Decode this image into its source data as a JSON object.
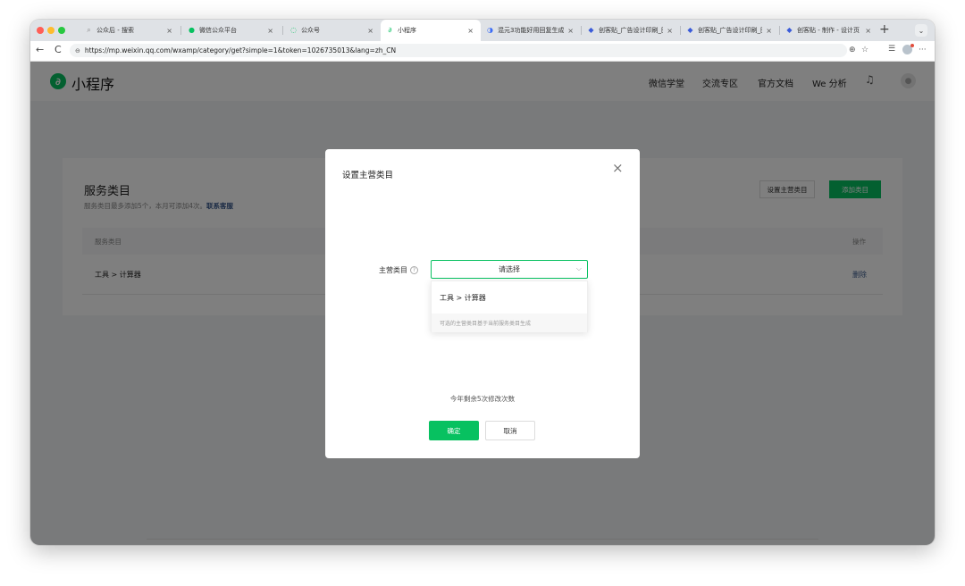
{
  "browser": {
    "tabs": [
      {
        "icon": "search-icon",
        "icon_glyph": "⌕",
        "icon_color": "#8a8a8a",
        "label": "公众后 - 搜索"
      },
      {
        "icon": "wechat-icon",
        "icon_glyph": "●",
        "icon_color": "#07c160",
        "label": "微信公众平台"
      },
      {
        "icon": "gongzhonghao-icon",
        "icon_glyph": "◌",
        "icon_color": "#07c160",
        "label": "公众号"
      },
      {
        "icon": "miniprogram-icon",
        "icon_glyph": "∂",
        "icon_color": "#07c160",
        "label": "小程序"
      },
      {
        "icon": "chatbot-icon",
        "icon_glyph": "◑",
        "icon_color": "#3b6cf6",
        "label": "混元3功能好用回复生成"
      },
      {
        "icon": "chuangkit-icon",
        "icon_glyph": "◆",
        "icon_color": "#3a5bd9",
        "label": "创客贴_广告设计印刷_图"
      },
      {
        "icon": "chuangkit-icon",
        "icon_glyph": "◆",
        "icon_color": "#3a5bd9",
        "label": "创客贴_广告设计印刷_图"
      },
      {
        "icon": "chuangkit-icon",
        "icon_glyph": "◆",
        "icon_color": "#3a5bd9",
        "label": "创客贴 - 制作 - 设计页"
      }
    ],
    "close_glyph": "×",
    "new_tab_glyph": "+",
    "tab_menu_glyph": "⌄",
    "back_glyph": "←",
    "forward_glyph": "C",
    "url": "https://mp.weixin.qq.com/wxamp/category/get?simple=1&token=1026735013&lang=zh_CN",
    "lock_glyph": "⊖",
    "translate_glyph": "⊕",
    "star_glyph": "☆",
    "favorites_glyph": "☰",
    "more_glyph": "···"
  },
  "app": {
    "logo_glyph": "∂",
    "title": "小程序",
    "nav": [
      "微信学堂",
      "交流专区",
      "官方文档",
      "We 分析"
    ],
    "bell_glyph": "♫",
    "avatar_glyph": "●",
    "accent_color": "#07c160"
  },
  "card": {
    "title": "服务类目",
    "subtitle": "服务类目最多添加5个，本月可添加4次。",
    "contact_link": "联系客服",
    "set_main_button": "设置主营类目",
    "add_button": "添加类目",
    "table": {
      "headers": [
        "服务类目",
        "操作"
      ],
      "rows": [
        {
          "category": "工具 > 计算器",
          "action": "删除"
        }
      ]
    }
  },
  "modal": {
    "title": "设置主营类目",
    "close_glyph": "×",
    "field_label": "主营类目",
    "help_glyph": "?",
    "select_placeholder": "请选择",
    "chevron_glyph": "⌵",
    "options": [
      "工具 > 计算器"
    ],
    "dropdown_note": "可选的主营类目基于当前服务类目生成",
    "remaining_text": "今年剩余5次修改次数",
    "confirm_button": "确定",
    "cancel_button": "取消"
  }
}
